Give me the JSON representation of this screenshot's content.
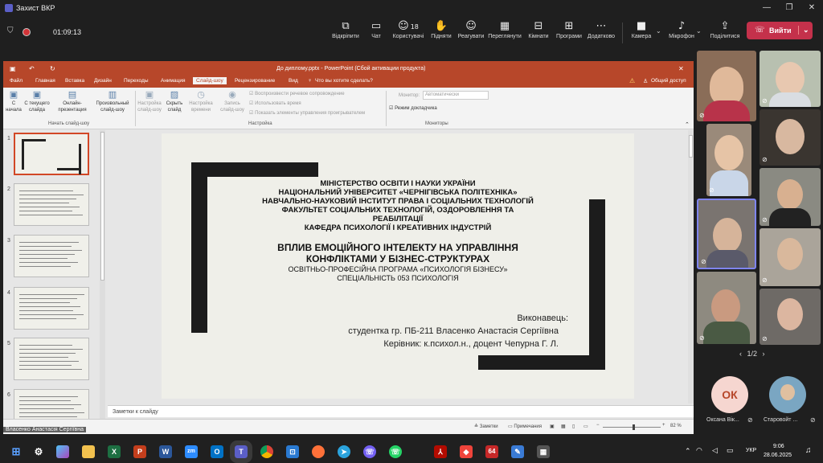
{
  "app": {
    "title": "Захист ВКР",
    "timer": "01:09:13"
  },
  "toolbar": {
    "items": [
      {
        "label": "Відкріпити",
        "icon": "unpin-icon"
      },
      {
        "label": "Чат",
        "icon": "chat-icon"
      },
      {
        "label": "Користувачі",
        "icon": "people-icon",
        "count": "18"
      },
      {
        "label": "Підняти",
        "icon": "raise-hand-icon"
      },
      {
        "label": "Реагувати",
        "icon": "react-icon"
      },
      {
        "label": "Переглянути",
        "icon": "view-icon"
      },
      {
        "label": "Кімнати",
        "icon": "rooms-icon"
      },
      {
        "label": "Програми",
        "icon": "apps-icon"
      },
      {
        "label": "Додатково",
        "icon": "more-icon"
      },
      {
        "label": "Камера",
        "icon": "camera-icon"
      },
      {
        "label": "Мікрофон",
        "icon": "mic-icon"
      },
      {
        "label": "Поділитися",
        "icon": "share-icon"
      }
    ],
    "leave_label": "Вийти"
  },
  "ppt": {
    "title": "До диплому.pptx - PowerPoint (Сбой активации продукта)",
    "tabs": [
      "Файл",
      "Главная",
      "Вставка",
      "Дизайн",
      "Переходы",
      "Анимация",
      "Слайд-шоу",
      "Рецензирование",
      "Вид"
    ],
    "tell_me": "Что вы хотите сделать?",
    "share": "Общий доступ",
    "ribbon": {
      "from_start": "С начала",
      "from_current": "С текущего слайда",
      "online": "Онлайн-презентация",
      "custom": "Произвольный слайд-шоу",
      "group1": "Начать слайд-шоу",
      "setup": "Настройка слайд-шоу",
      "hide": "Скрыть слайд",
      "rehearse": "Настройка времени",
      "record": "Запись слайд-шоу",
      "chk1": "Воспроизвести речевое сопровождение",
      "chk2": "Использовать время",
      "chk3": "Показать элементы управления проигрывателем",
      "group2": "Настройка",
      "monitor_label": "Монитор:",
      "monitor_value": "Автоматически",
      "presenter": "Режим докладчика",
      "group3": "Мониторы"
    },
    "slide_numbers": [
      "1",
      "2",
      "3",
      "4",
      "5",
      "6"
    ],
    "slide": {
      "l1": "МІНІСТЕРСТВО ОСВІТИ І НАУКИ УКРАЇНИ",
      "l2": "НАЦІОНАЛЬНИЙ УНІВЕРСИТЕТ «ЧЕРНІГІВСЬКА ПОЛІТЕХНІКА»",
      "l3": "НАВЧАЛЬНО-НАУКОВИЙ ІНСТИТУТ ПРАВА І СОЦІАЛЬНИХ ТЕХНОЛОГІЙ",
      "l4": "ФАКУЛЬТЕТ СОЦІАЛЬНИХ ТЕХНОЛОГІЙ, ОЗДОРОВЛЕННЯ ТА",
      "l5": "РЕАБІЛІТАЦІЇ",
      "l6": "КАФЕДРА ПСИХОЛОГІЇ І КРЕАТИВНИХ ІНДУСТРІЙ",
      "t1": "ВПЛИВ ЕМОЦІЙНОГО ІНТЕЛЕКТУ НА УПРАВЛІННЯ",
      "t2": "КОНФЛІКТАМИ У БІЗНЕС-СТРУКТУРАХ",
      "p1": "ОСВІТНЬО-ПРОФЕСІЙНА ПРОГРАМА «ПСИХОЛОГІЯ БІЗНЕСУ»",
      "p2": "СПЕЦІАЛЬНІСТЬ 053 ПСИХОЛОГІЯ",
      "e1": "Виконавець:",
      "e2": "студентка гр. ПБ-211 Власенко Анастасія Сергіївна",
      "e3": "Керівник: к.психол.н., доцент Чепурна Г. Л."
    },
    "notes": "Заметки к слайду",
    "status_notes": "Заметки",
    "status_comments": "Примечания",
    "zoom": "82 %"
  },
  "presenter_name": "Власенко Анастасія Сергіївна",
  "participants": {
    "page": "1/2",
    "avatar_initials": "ОК",
    "name1": "Оксана Вік...",
    "name2": "Старовойт ..."
  },
  "taskbar": {
    "lang": "УКР",
    "time": "9:06",
    "date": "28.06.2025",
    "badge": "64"
  },
  "colors": {
    "ppt_accent": "#b7472a",
    "leave": "#c4314b",
    "avatar_bg": "#f6d6d0",
    "avatar_fg": "#b7472a"
  }
}
